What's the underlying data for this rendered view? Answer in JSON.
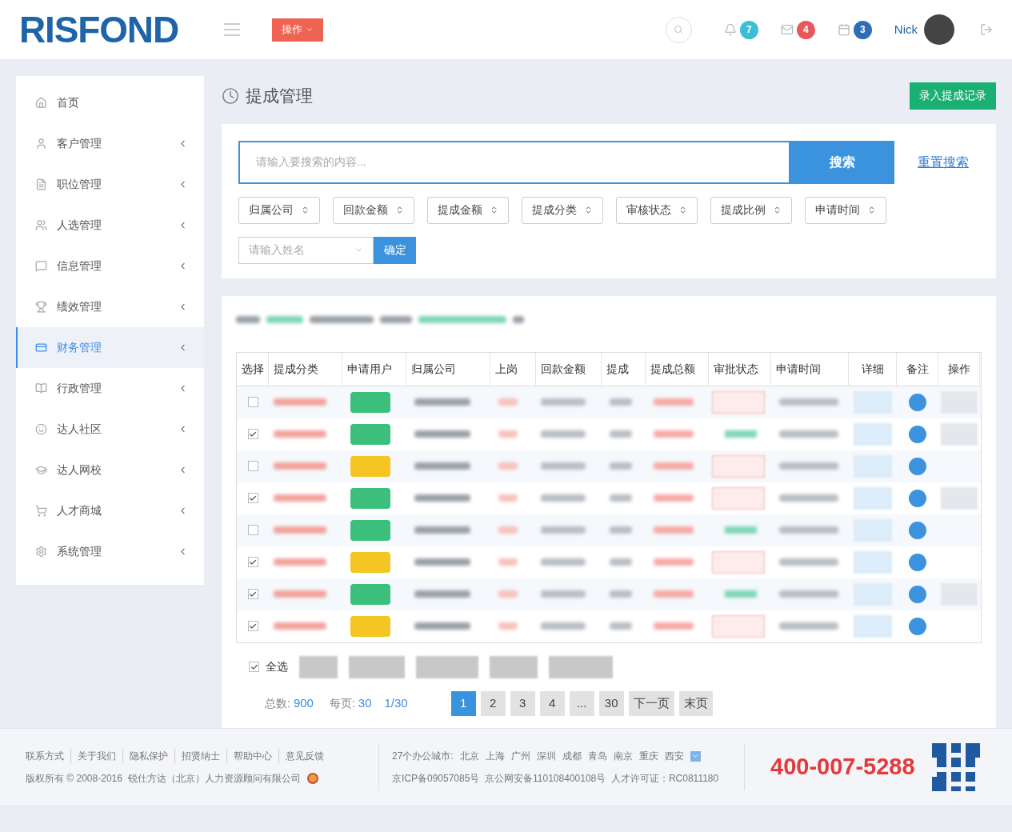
{
  "header": {
    "logo": "RISFOND",
    "action_button": "操作",
    "badges": [
      {
        "kind": "bell",
        "count": "7",
        "color": "#3bbfd6"
      },
      {
        "kind": "mail",
        "count": "4",
        "color": "#e8585a"
      },
      {
        "kind": "calendar",
        "count": "3",
        "color": "#2f6db5"
      }
    ],
    "user": "Nick"
  },
  "sidebar": {
    "items": [
      {
        "label": "首页",
        "selected": false
      },
      {
        "label": "客户管理",
        "selected": false
      },
      {
        "label": "职位管理",
        "selected": false
      },
      {
        "label": "人选管理",
        "selected": false
      },
      {
        "label": "信息管理",
        "selected": false
      },
      {
        "label": "绩效管理",
        "selected": false
      },
      {
        "label": "财务管理",
        "selected": true
      },
      {
        "label": "行政管理",
        "selected": false
      },
      {
        "label": "达人社区",
        "selected": false
      },
      {
        "label": "达人网校",
        "selected": false
      },
      {
        "label": "人才商城",
        "selected": false
      },
      {
        "label": "系统管理",
        "selected": false
      }
    ]
  },
  "page": {
    "title": "提成管理",
    "add_button": "录入提成记录"
  },
  "search": {
    "placeholder": "请输入要搜索的内容...",
    "button": "搜索",
    "reset": "重置搜索",
    "filters": [
      "归属公司",
      "回款金额",
      "提成金额",
      "提成分类",
      "审核状态",
      "提成比例",
      "申请时间"
    ],
    "name_placeholder": "请输入姓名",
    "confirm": "确定"
  },
  "table": {
    "columns": [
      "选择",
      "提成分类",
      "申请用户",
      "归属公司",
      "上岗",
      "回款金额",
      "提成",
      "提成总额",
      "审批状态",
      "申请时间",
      "详细",
      "备注",
      "操作"
    ],
    "rows": [
      {
        "checked": false,
        "color": "#3cbf7a",
        "approved": false,
        "has_action": true
      },
      {
        "checked": true,
        "color": "#3cbf7a",
        "approved": true,
        "has_action": true
      },
      {
        "checked": false,
        "color": "#f5c523",
        "approved": false,
        "has_action": false
      },
      {
        "checked": true,
        "color": "#3cbf7a",
        "approved": false,
        "has_action": true
      },
      {
        "checked": false,
        "color": "#3cbf7a",
        "approved": true,
        "has_action": false
      },
      {
        "checked": true,
        "color": "#f5c523",
        "approved": false,
        "has_action": false
      },
      {
        "checked": true,
        "color": "#3cbf7a",
        "approved": true,
        "has_action": true
      },
      {
        "checked": true,
        "color": "#f5c523",
        "approved": false,
        "has_action": false
      }
    ]
  },
  "bulk": {
    "select_all": "全选",
    "checked": true
  },
  "pagination": {
    "total_label": "总数:",
    "total": "900",
    "per_page_label": "每页:",
    "per_page": "30",
    "page_of": "1/30",
    "pages": [
      {
        "label": "1",
        "selected": true
      },
      {
        "label": "2",
        "selected": false
      },
      {
        "label": "3",
        "selected": false
      },
      {
        "label": "4",
        "selected": false
      },
      {
        "label": "...",
        "selected": false
      },
      {
        "label": "30",
        "selected": false
      },
      {
        "label": "下一页",
        "selected": false
      },
      {
        "label": "末页",
        "selected": false
      }
    ]
  },
  "footer": {
    "links": [
      "联系方式",
      "关于我们",
      "隐私保护",
      "招贤纳士",
      "帮助中心",
      "意见反馈"
    ],
    "copyright": "版权所有 © 2008-2016  锐仕方达（北京）人力资源顾问有限公司",
    "cities_label": "27个办公城市:",
    "cities": [
      "北京",
      "上海",
      "广州",
      "深圳",
      "成都",
      "青岛",
      "南京",
      "重庆",
      "西安"
    ],
    "license": "京ICP备09057085号  京公网安备110108400108号  人才许可证：RC0811180",
    "phone": "400-007-5288"
  }
}
